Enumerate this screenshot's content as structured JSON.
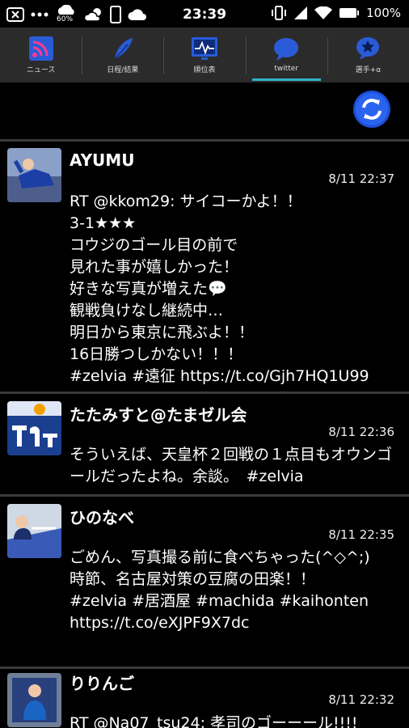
{
  "status": {
    "time": "23:39",
    "battery": "100%",
    "net_pct": "60%"
  },
  "tabs": [
    {
      "label": "ニュース"
    },
    {
      "label": "日程/結果"
    },
    {
      "label": "順位表"
    },
    {
      "label": "twitter"
    },
    {
      "label": "選手+α"
    }
  ],
  "tweets": [
    {
      "name": "AYUMU",
      "time": "8/11 22:37",
      "body": "RT @kkom29: サイコーかよ！！\n3-1★★★\nコウジのゴール目の前で\n見れた事が嬉しかった！\n好きな写真が増えた💬\n観戦負けなし継続中…\n明日から東京に飛ぶよ！！\n16日勝つしかない！！！\n#zelvia #遠征 https://t.co/Gjh7HQ1U99"
    },
    {
      "name": "たたみすと@たまゼル会",
      "time": "8/11 22:36",
      "body": "そういえば、天皇杯２回戦の１点目もオウンゴールだったよね。余談。　#zelvia"
    },
    {
      "name": "ひのなべ",
      "time": "8/11 22:35",
      "body": "ごめん、写真撮る前に食べちゃった(^◇^;)\n時節、名古屋対策の豆腐の田楽！！\n#zelvia #居酒屋 #machida #kaihonten\nhttps://t.co/eXJPF9X7dc"
    },
    {
      "name": "りりんご",
      "time": "8/11 22:32",
      "body": "RT @Na07_tsu24: 孝司のゴーーール!!!!"
    }
  ],
  "colors": {
    "accent": "#2fb4c7",
    "icon_blue": "#2a5bd7"
  }
}
